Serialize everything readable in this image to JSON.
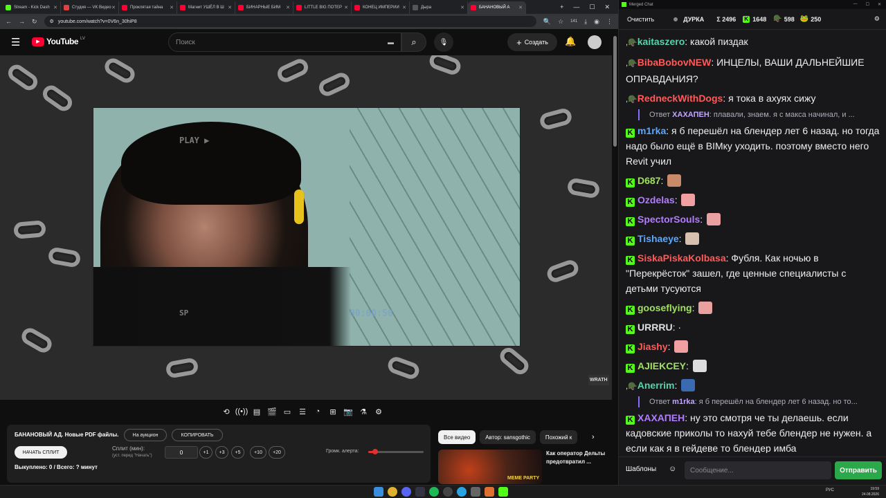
{
  "browser": {
    "tabs": [
      {
        "label": "Stream - Kick Dash",
        "color": "#53fc18"
      },
      {
        "label": "Студия — VK Видео",
        "color": "#e04040"
      },
      {
        "label": "Проклятая тайна",
        "color": "#ff0033"
      },
      {
        "label": "Магнит УШЁЛ В Ш",
        "color": "#ff0033"
      },
      {
        "label": "БИНАРНЫЕ БИМ",
        "color": "#ff0033"
      },
      {
        "label": "LITTLE BIG ПОТЕР",
        "color": "#ff0033"
      },
      {
        "label": "КОНЕЦ ИМПЕРИИ",
        "color": "#ff0033"
      },
      {
        "label": "Дыра",
        "color": "#555555"
      },
      {
        "label": "БАНАНОВЫЙ А",
        "color": "#ff0033"
      }
    ],
    "new_tab": "+",
    "url": "youtube.com/watch?v=0V6n_30hiP8",
    "badge_count": "141"
  },
  "youtube": {
    "logo": "YouTube",
    "logo_region": "LV",
    "search_placeholder": "Поиск",
    "create_label": "Создать"
  },
  "video": {
    "overlay_play": "PLAY ▶",
    "overlay_sp": "SP",
    "overlay_time": "00:00:50",
    "watermark": "WRATH"
  },
  "player_controls": [
    "⟲",
    "((•))",
    "▤",
    "🎬",
    "▭",
    "☰",
    "◔",
    "⊞",
    "📷",
    "⚗",
    "⚙"
  ],
  "auction_panel": {
    "title": "БАНАНОВЫЙ АД. Новые PDF файлы.",
    "auction_button": "На аукцион",
    "copy_button": "КОПИРОВАТЬ",
    "start_split_button": "НАЧАТЬ СПЛИТ",
    "split_label": "Сплит (мин):",
    "split_hint": "(уст. перед \"Начать\")",
    "split_value": "0",
    "increments": [
      "+1",
      "+3",
      "+5",
      "+10",
      "+20"
    ],
    "volume_label": "Громк. алерта:",
    "volume_level": 0.12,
    "bought_text": "Выкуплено: 0 / Всего: ? минут"
  },
  "side": {
    "tabs": [
      "Все видео",
      "Автор: sansgothic",
      "Похожий к"
    ],
    "rec_title": "Как оператор Дельты предотвратил ...",
    "rec_badge": "MEME PARTY"
  },
  "chat": {
    "window_title": "Merged Chat",
    "clear_button": "Очистить",
    "channel": "ДУРКА",
    "total": "Σ 2496",
    "kick_count": "1648",
    "vk_count": "598",
    "other_count": "250",
    "messages": [
      {
        "platform": "vk",
        "name": "kaitaszero",
        "color": "#57d4a8",
        "text": "какой пиздак"
      },
      {
        "platform": "vk",
        "name": "BibaBobovNEW",
        "color": "#ff5a5a",
        "text": "ИНЦЕЛЫ, ВАШИ ДАЛЬНЕЙШИЕ ОПРАВДАНИЯ?"
      },
      {
        "platform": "vk",
        "name": "RedneckWithDogs",
        "color": "#ff5a5a",
        "text": "я тока в ахуях сижу"
      },
      {
        "platform": "kick",
        "name": "m1rka",
        "color": "#5aa8ff",
        "text": "я б перешёл на блендер лет 6 назад. но тогда надо было ещё в BIMку уходить. поэтому вместо него Revit учил"
      },
      {
        "platform": "kick",
        "name": "D687",
        "color": "#a0e060",
        "text": ""
      },
      {
        "platform": "kick",
        "name": "Ozdelas",
        "color": "#b27cff",
        "text": ""
      },
      {
        "platform": "kick",
        "name": "SpectorSouls",
        "color": "#b27cff",
        "text": ""
      },
      {
        "platform": "kick",
        "name": "Tishaeye",
        "color": "#5aa8ff",
        "text": ""
      },
      {
        "platform": "kick",
        "name": "SiskaPiskaKolbasa",
        "color": "#ff5a5a",
        "text": "Фубля. Как ночью в \"Перекрёсток\" зашел, где ценные специалисты с детьми тусуются"
      },
      {
        "platform": "kick",
        "name": "gooseflying",
        "color": "#a0e060",
        "text": ""
      },
      {
        "platform": "kick",
        "name": "URRRU",
        "color": "#e0e0e0",
        "text": "·"
      },
      {
        "platform": "kick",
        "name": "Jiashy",
        "color": "#ff5a5a",
        "text": ""
      },
      {
        "platform": "kick",
        "name": "AJIEKCEY",
        "color": "#a0e060",
        "text": ""
      },
      {
        "platform": "vk",
        "name": "Anerrim",
        "color": "#57d4a8",
        "text": ""
      },
      {
        "platform": "kick",
        "name": "ХАХАПЕН",
        "color": "#b27cff",
        "text": "ну это смотря че ты делаешь. если кадовские приколы то нахуй тебе блендер не нужен. а если как я в гейдеве то блендер имба"
      }
    ],
    "replies": {
      "r1": {
        "prefix": "Ответ",
        "to": "ХАХАПЕН",
        "text": "плавали, знаем. я с макса начинал, и ..."
      },
      "r2": {
        "prefix": "Ответ",
        "to": "m1rka",
        "text": "я б перешёл на блендер лет 6 назад. но то..."
      }
    },
    "templates_button": "Шаблоны",
    "message_placeholder": "Сообщение...",
    "send_button": "Отправить"
  },
  "taskbar": {
    "lang": "РУС",
    "time": "19:59",
    "date": "24.08.2026"
  }
}
